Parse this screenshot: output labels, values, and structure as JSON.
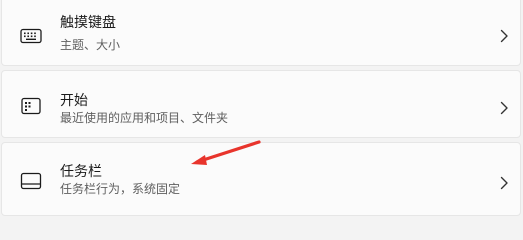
{
  "settings_items": [
    {
      "title": "触摸键盘",
      "subtitle": "主题、大小",
      "icon": "keyboard-icon"
    },
    {
      "title": "开始",
      "subtitle": "最近使用的应用和项目、文件夹",
      "icon": "start-menu-icon"
    },
    {
      "title": "任务栏",
      "subtitle": "任务栏行为，系统固定",
      "icon": "taskbar-icon"
    }
  ],
  "colors": {
    "annotation_arrow": "#e8342c",
    "card_background": "#fbfbfb",
    "page_background": "#f3f3f3"
  }
}
